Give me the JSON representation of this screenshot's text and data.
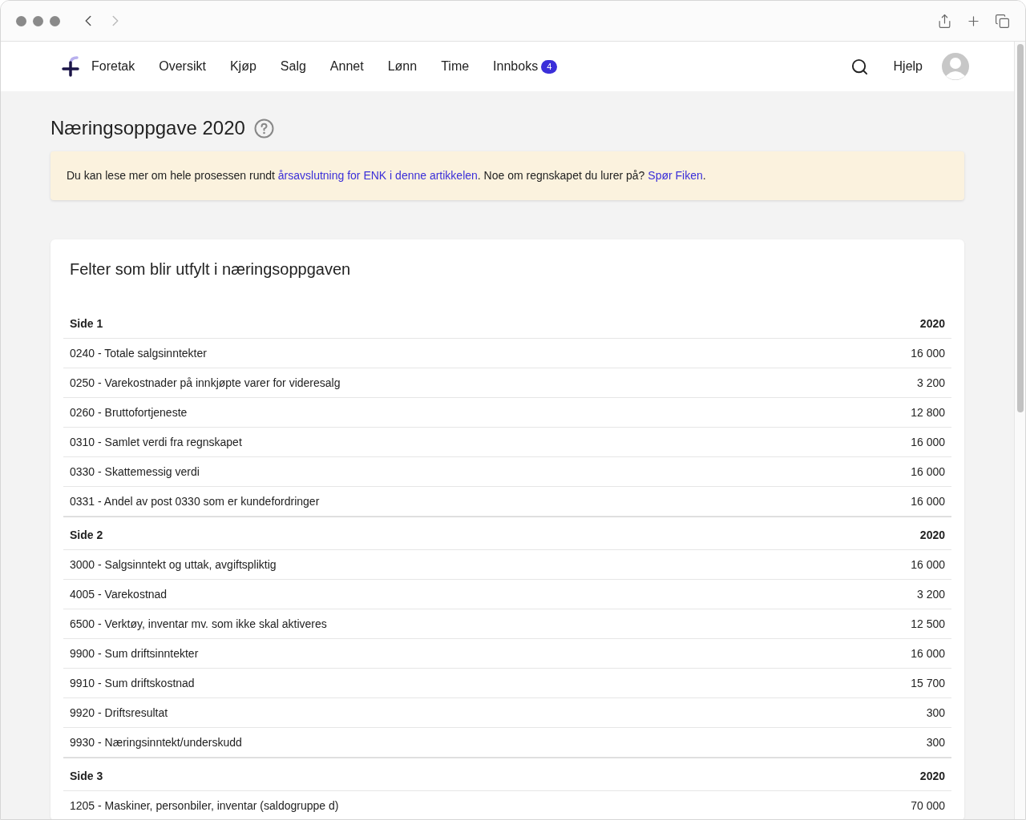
{
  "nav": {
    "items": [
      {
        "label": "Foretak"
      },
      {
        "label": "Oversikt"
      },
      {
        "label": "Kjøp"
      },
      {
        "label": "Salg"
      },
      {
        "label": "Annet"
      },
      {
        "label": "Lønn"
      },
      {
        "label": "Time"
      },
      {
        "label": "Innboks",
        "badge": "4"
      }
    ],
    "help": "Hjelp"
  },
  "page": {
    "title": "Næringsoppgave 2020"
  },
  "notice": [
    {
      "kind": "text",
      "text": "Du kan lese mer om hele prosessen rundt "
    },
    {
      "kind": "link",
      "text": "årsavslutning for ENK i denne artikkelen"
    },
    {
      "kind": "text",
      "text": ". Noe om regnskapet du lurer på? "
    },
    {
      "kind": "link",
      "text": "Spør Fiken"
    },
    {
      "kind": "text",
      "text": "."
    }
  ],
  "card": {
    "title": "Felter som blir utfylt i næringsoppgaven",
    "sections": [
      {
        "name": "Side 1",
        "year": "2020",
        "rows": [
          [
            "0240 - Totale salgsinntekter",
            "16 000"
          ],
          [
            "0250 - Varekostnader på innkjøpte varer for videresalg",
            "3 200"
          ],
          [
            "0260 - Bruttofortjeneste",
            "12 800"
          ],
          [
            "0310 - Samlet verdi fra regnskapet",
            "16 000"
          ],
          [
            "0330 - Skattemessig verdi",
            "16 000"
          ],
          [
            "0331 - Andel av post 0330 som er kundefordringer",
            "16 000"
          ]
        ]
      },
      {
        "name": "Side 2",
        "year": "2020",
        "rows": [
          [
            "3000 - Salgsinntekt og uttak, avgiftspliktig",
            "16 000"
          ],
          [
            "4005 - Varekostnad",
            "3 200"
          ],
          [
            "6500 - Verktøy, inventar mv. som ikke skal aktiveres",
            "12 500"
          ],
          [
            "9900 - Sum driftsinntekter",
            "16 000"
          ],
          [
            "9910 - Sum driftskostnad",
            "15 700"
          ],
          [
            "9920 - Driftsresultat",
            "300"
          ],
          [
            "9930 - Næringsinntekt/underskudd",
            "300"
          ]
        ]
      },
      {
        "name": "Side 3",
        "year": "2020",
        "rows": [
          [
            "1205 - Maskiner, personbiler, inventar (saldogruppe d)",
            "70 000"
          ]
        ]
      }
    ]
  }
}
